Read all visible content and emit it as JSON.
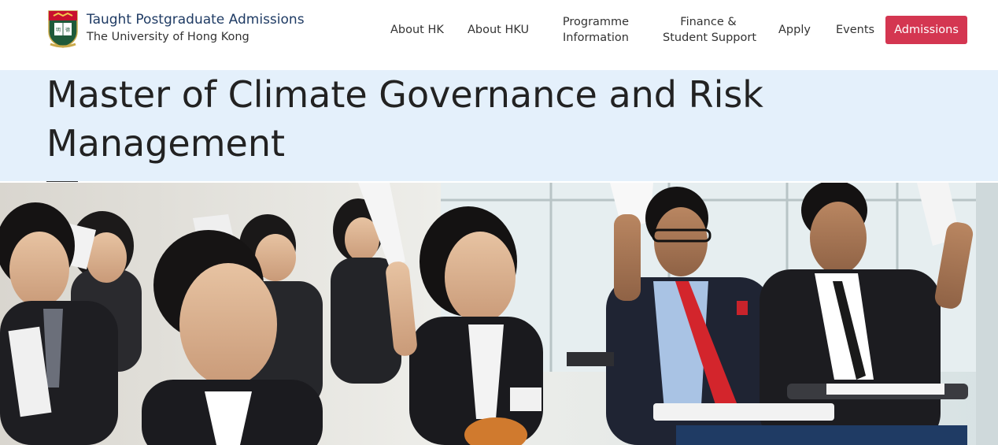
{
  "brand": {
    "title": "Taught Postgraduate Admissions",
    "subtitle": "The University of Hong Kong"
  },
  "nav": {
    "items": [
      {
        "label_1": "About HK",
        "label_2": ""
      },
      {
        "label_1": "About HKU",
        "label_2": ""
      },
      {
        "label_1": "Programme",
        "label_2": "Information"
      },
      {
        "label_1": "Finance &",
        "label_2": "Student Support"
      },
      {
        "label_1": "Apply",
        "label_2": ""
      },
      {
        "label_1": "Events",
        "label_2": ""
      }
    ],
    "cta": "Admissions"
  },
  "page": {
    "title": "Master of Climate Governance and Risk Management"
  },
  "colors": {
    "brand_blue": "#1f3b64",
    "cta_red": "#d43651",
    "title_band": "#e4f0fb"
  }
}
